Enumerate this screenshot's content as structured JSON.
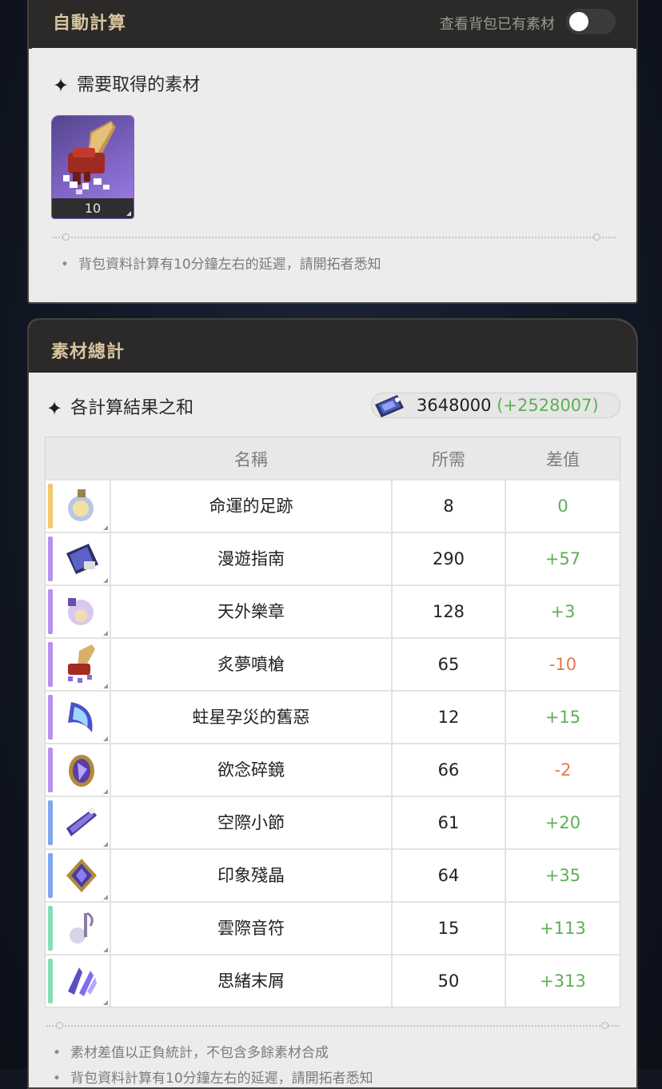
{
  "auto_calc": {
    "title": "自動計算",
    "toggle_label": "查看背包已有素材",
    "toggle_on": false,
    "section_title": "需要取得的素材",
    "required_item": {
      "name": "炙夢噴槍",
      "count": "10",
      "icon": "spray-gun-icon"
    },
    "note": "背包資料計算有10分鐘左右的延遲，請開拓者悉知"
  },
  "summary": {
    "title": "素材總計",
    "section_title": "各計算結果之和",
    "credits_value": "3648000",
    "credits_diff": "(+2528007)",
    "credits_icon": "credit-card-icon",
    "columns": {
      "name": "名稱",
      "need": "所需",
      "diff": "差值"
    },
    "rows": [
      {
        "name": "命運的足跡",
        "need": "8",
        "diff": "0",
        "rarity_color": "#f1c86a",
        "icon": "fate-footprint-icon",
        "sign": "zero"
      },
      {
        "name": "漫遊指南",
        "need": "290",
        "diff": "+57",
        "rarity_color": "#b690ee",
        "icon": "travel-guide-icon",
        "sign": "pos"
      },
      {
        "name": "天外樂章",
        "need": "128",
        "diff": "+3",
        "rarity_color": "#b690ee",
        "icon": "music-sheet-icon",
        "sign": "pos"
      },
      {
        "name": "炙夢噴槍",
        "need": "65",
        "diff": "-10",
        "rarity_color": "#b690ee",
        "icon": "spray-gun-icon",
        "sign": "neg"
      },
      {
        "name": "蛀星孕災的舊惡",
        "need": "12",
        "diff": "+15",
        "rarity_color": "#b690ee",
        "icon": "star-blade-icon",
        "sign": "pos"
      },
      {
        "name": "欲念碎鏡",
        "need": "66",
        "diff": "-2",
        "rarity_color": "#b690ee",
        "icon": "mirror-shard-icon",
        "sign": "neg"
      },
      {
        "name": "空際小節",
        "need": "61",
        "diff": "+20",
        "rarity_color": "#7fa6ee",
        "icon": "measure-icon",
        "sign": "pos"
      },
      {
        "name": "印象殘晶",
        "need": "64",
        "diff": "+35",
        "rarity_color": "#7fa6ee",
        "icon": "crystal-icon",
        "sign": "pos"
      },
      {
        "name": "雲際音符",
        "need": "15",
        "diff": "+113",
        "rarity_color": "#86dfb4",
        "icon": "music-note-icon",
        "sign": "pos"
      },
      {
        "name": "思緒末屑",
        "need": "50",
        "diff": "+313",
        "rarity_color": "#86dfb4",
        "icon": "thought-shard-icon",
        "sign": "pos"
      }
    ],
    "notes": [
      "素材差值以正負統計，不包含多餘素材合成",
      "背包資料計算有10分鐘左右的延遲，請開拓者悉知"
    ]
  }
}
